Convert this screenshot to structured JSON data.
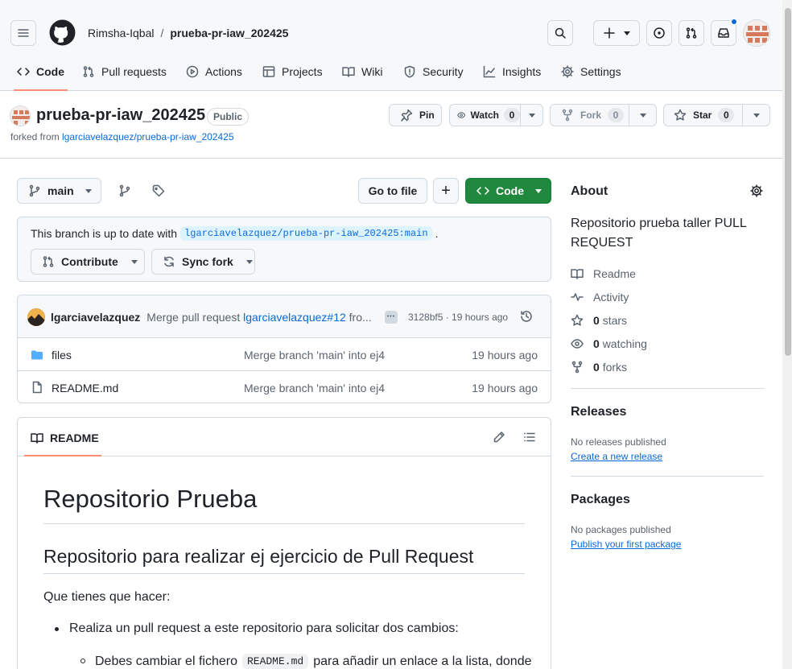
{
  "header": {
    "owner": "Rimsha-Iqbal",
    "separator": "/",
    "repo": "prueba-pr-iaw_202425"
  },
  "nav": {
    "tabs": [
      {
        "label": "Code",
        "icon": "code-icon"
      },
      {
        "label": "Pull requests",
        "icon": "pull-request-icon"
      },
      {
        "label": "Actions",
        "icon": "play-icon"
      },
      {
        "label": "Projects",
        "icon": "table-icon"
      },
      {
        "label": "Wiki",
        "icon": "book-icon"
      },
      {
        "label": "Security",
        "icon": "shield-icon"
      },
      {
        "label": "Insights",
        "icon": "graph-icon"
      },
      {
        "label": "Settings",
        "icon": "gear-icon"
      }
    ]
  },
  "repo": {
    "name": "prueba-pr-iaw_202425",
    "visibility": "Public",
    "forked_prefix": "forked from",
    "forked_from": "lgarciavelazquez/prueba-pr-iaw_202425",
    "pin_label": "Pin",
    "watch_label": "Watch",
    "watch_count": "0",
    "fork_label": "Fork",
    "fork_count": "0",
    "star_label": "Star",
    "star_count": "0"
  },
  "toolbar": {
    "branch": "main",
    "goto_file": "Go to file",
    "add": "+",
    "code": "Code"
  },
  "branch_status": {
    "text": "This branch is up to date with",
    "ref": "lgarciavelazquez/prueba-pr-iaw_202425:main",
    "period": ".",
    "contribute": "Contribute",
    "sync_fork": "Sync fork"
  },
  "commit": {
    "author": "lgarciavelazquez",
    "message": "Merge pull request",
    "pr_link": "lgarciavelazquez#12",
    "message_tail": "fro...",
    "ellipsis": "•••",
    "sha_time": "3128bf5 · 19 hours ago"
  },
  "files": [
    {
      "name": "files",
      "type": "folder",
      "message": "Merge branch 'main' into ej4",
      "time": "19 hours ago"
    },
    {
      "name": "README.md",
      "type": "file",
      "message": "Merge branch 'main' into ej4",
      "time": "19 hours ago"
    }
  ],
  "readme": {
    "tab_label": "README",
    "h1": "Repositorio Prueba",
    "h2": "Repositorio para realizar ej ejercicio de Pull Request",
    "p1": "Que tienes que hacer:",
    "li1": "Realiza un pull request a este repositorio para solicitar dos cambios:",
    "li2_before": "Debes cambiar el fichero",
    "li2_code": "README.md",
    "li2_after": "para añadir un enlace a la lista, donde"
  },
  "about": {
    "title": "About",
    "description": "Repositorio prueba taller PULL REQUEST",
    "items": [
      {
        "icon": "book-icon",
        "bold": "",
        "text": "Readme"
      },
      {
        "icon": "pulse-icon",
        "bold": "",
        "text": "Activity"
      },
      {
        "icon": "star-icon",
        "bold": "0",
        "text": "stars"
      },
      {
        "icon": "eye-icon",
        "bold": "0",
        "text": "watching"
      },
      {
        "icon": "fork-icon",
        "bold": "0",
        "text": "forks"
      }
    ]
  },
  "releases": {
    "title": "Releases",
    "empty": "No releases published",
    "link": "Create a new release"
  },
  "packages": {
    "title": "Packages",
    "empty": "No packages published",
    "link": "Publish your first package"
  },
  "colors": {
    "accent": "#0969da",
    "primary_button": "#1f883d",
    "tab_underline": "#fd8c73",
    "border": "#d1d9e0"
  }
}
